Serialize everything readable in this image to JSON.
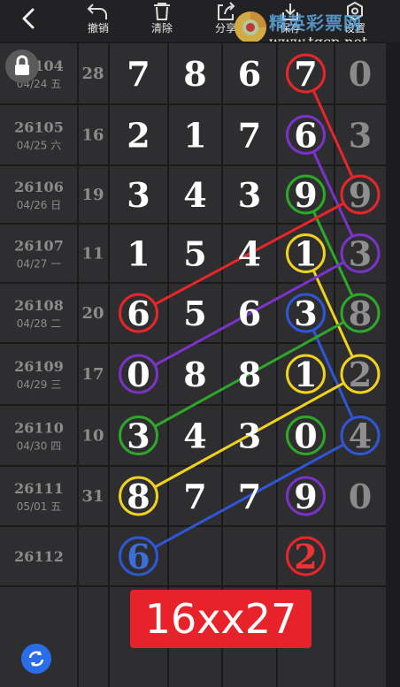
{
  "toolbar": {
    "back": "back-arrow",
    "items": [
      {
        "label": "撤销",
        "icon": "undo-icon"
      },
      {
        "label": "清除",
        "icon": "trash-icon"
      },
      {
        "label": "分享",
        "icon": "share-icon"
      },
      {
        "label": "保存",
        "icon": "download-icon"
      },
      {
        "label": "设置",
        "icon": "settings-icon"
      }
    ]
  },
  "watermark": {
    "text": "精英彩票网",
    "url": "www.tqcp.net"
  },
  "rows": [
    {
      "issue": "26104",
      "date": "04/24",
      "weekday": "五",
      "sum": "28",
      "digits": [
        "7",
        "8",
        "6",
        "7"
      ],
      "extra": "0",
      "extra_color": "#8a8a8a"
    },
    {
      "issue": "26105",
      "date": "04/25",
      "weekday": "六",
      "sum": "16",
      "digits": [
        "2",
        "1",
        "7",
        "6"
      ],
      "extra": "3",
      "extra_color": "#8a8a8a"
    },
    {
      "issue": "26106",
      "date": "04/26",
      "weekday": "日",
      "sum": "19",
      "digits": [
        "3",
        "4",
        "3",
        "9"
      ],
      "extra": "9",
      "extra_color": "#8a8a8a"
    },
    {
      "issue": "26107",
      "date": "04/27",
      "weekday": "一",
      "sum": "11",
      "digits": [
        "1",
        "5",
        "4",
        "1"
      ],
      "extra": "3",
      "extra_color": "#8a8a8a"
    },
    {
      "issue": "26108",
      "date": "04/28",
      "weekday": "二",
      "sum": "20",
      "digits": [
        "6",
        "5",
        "6",
        "3"
      ],
      "extra": "8",
      "extra_color": "#8a8a8a"
    },
    {
      "issue": "26109",
      "date": "04/29",
      "weekday": "三",
      "sum": "17",
      "digits": [
        "0",
        "8",
        "8",
        "1"
      ],
      "extra": "2",
      "extra_color": "#8a8a8a"
    },
    {
      "issue": "26110",
      "date": "04/30",
      "weekday": "四",
      "sum": "10",
      "digits": [
        "3",
        "4",
        "3",
        "0"
      ],
      "extra": "4",
      "extra_color": "#8a8a8a"
    },
    {
      "issue": "26111",
      "date": "05/01",
      "weekday": "五",
      "sum": "31",
      "digits": [
        "8",
        "7",
        "7",
        "9"
      ],
      "extra": "0",
      "extra_color": "#8a8a8a"
    },
    {
      "issue": "26112",
      "date": "",
      "weekday": "",
      "sum": "",
      "digits": [
        "6",
        "",
        "",
        "2"
      ],
      "extra": "",
      "extra_color": "#8a8a8a"
    }
  ],
  "colors": {
    "red": "#e8262a",
    "purple": "#7a32c8",
    "green": "#2ea829",
    "yellow": "#f0d21e",
    "blue": "#2f56d6",
    "pending_blue": "#3a6ed8",
    "pending_red": "#e33"
  },
  "circles": [
    {
      "row": 0,
      "col": 3,
      "color": "red"
    },
    {
      "row": 1,
      "col": 3,
      "color": "purple"
    },
    {
      "row": 2,
      "col": 3,
      "color": "green"
    },
    {
      "row": 3,
      "col": 3,
      "color": "yellow"
    },
    {
      "row": 4,
      "col": 3,
      "color": "blue"
    },
    {
      "row": 2,
      "col": 4,
      "color": "red"
    },
    {
      "row": 3,
      "col": 4,
      "color": "purple"
    },
    {
      "row": 4,
      "col": 4,
      "color": "green"
    },
    {
      "row": 5,
      "col": 4,
      "color": "yellow"
    },
    {
      "row": 6,
      "col": 4,
      "color": "blue"
    },
    {
      "row": 4,
      "col": 0,
      "color": "red"
    },
    {
      "row": 5,
      "col": 0,
      "color": "purple"
    },
    {
      "row": 6,
      "col": 0,
      "color": "green"
    },
    {
      "row": 7,
      "col": 0,
      "color": "yellow"
    },
    {
      "row": 8,
      "col": 0,
      "color": "blue"
    },
    {
      "row": 5,
      "col": 3,
      "color": "yellow"
    },
    {
      "row": 6,
      "col": 3,
      "color": "green"
    },
    {
      "row": 7,
      "col": 3,
      "color": "purple"
    },
    {
      "row": 8,
      "col": 3,
      "color": "red"
    }
  ],
  "result": {
    "text": "16xx27"
  }
}
